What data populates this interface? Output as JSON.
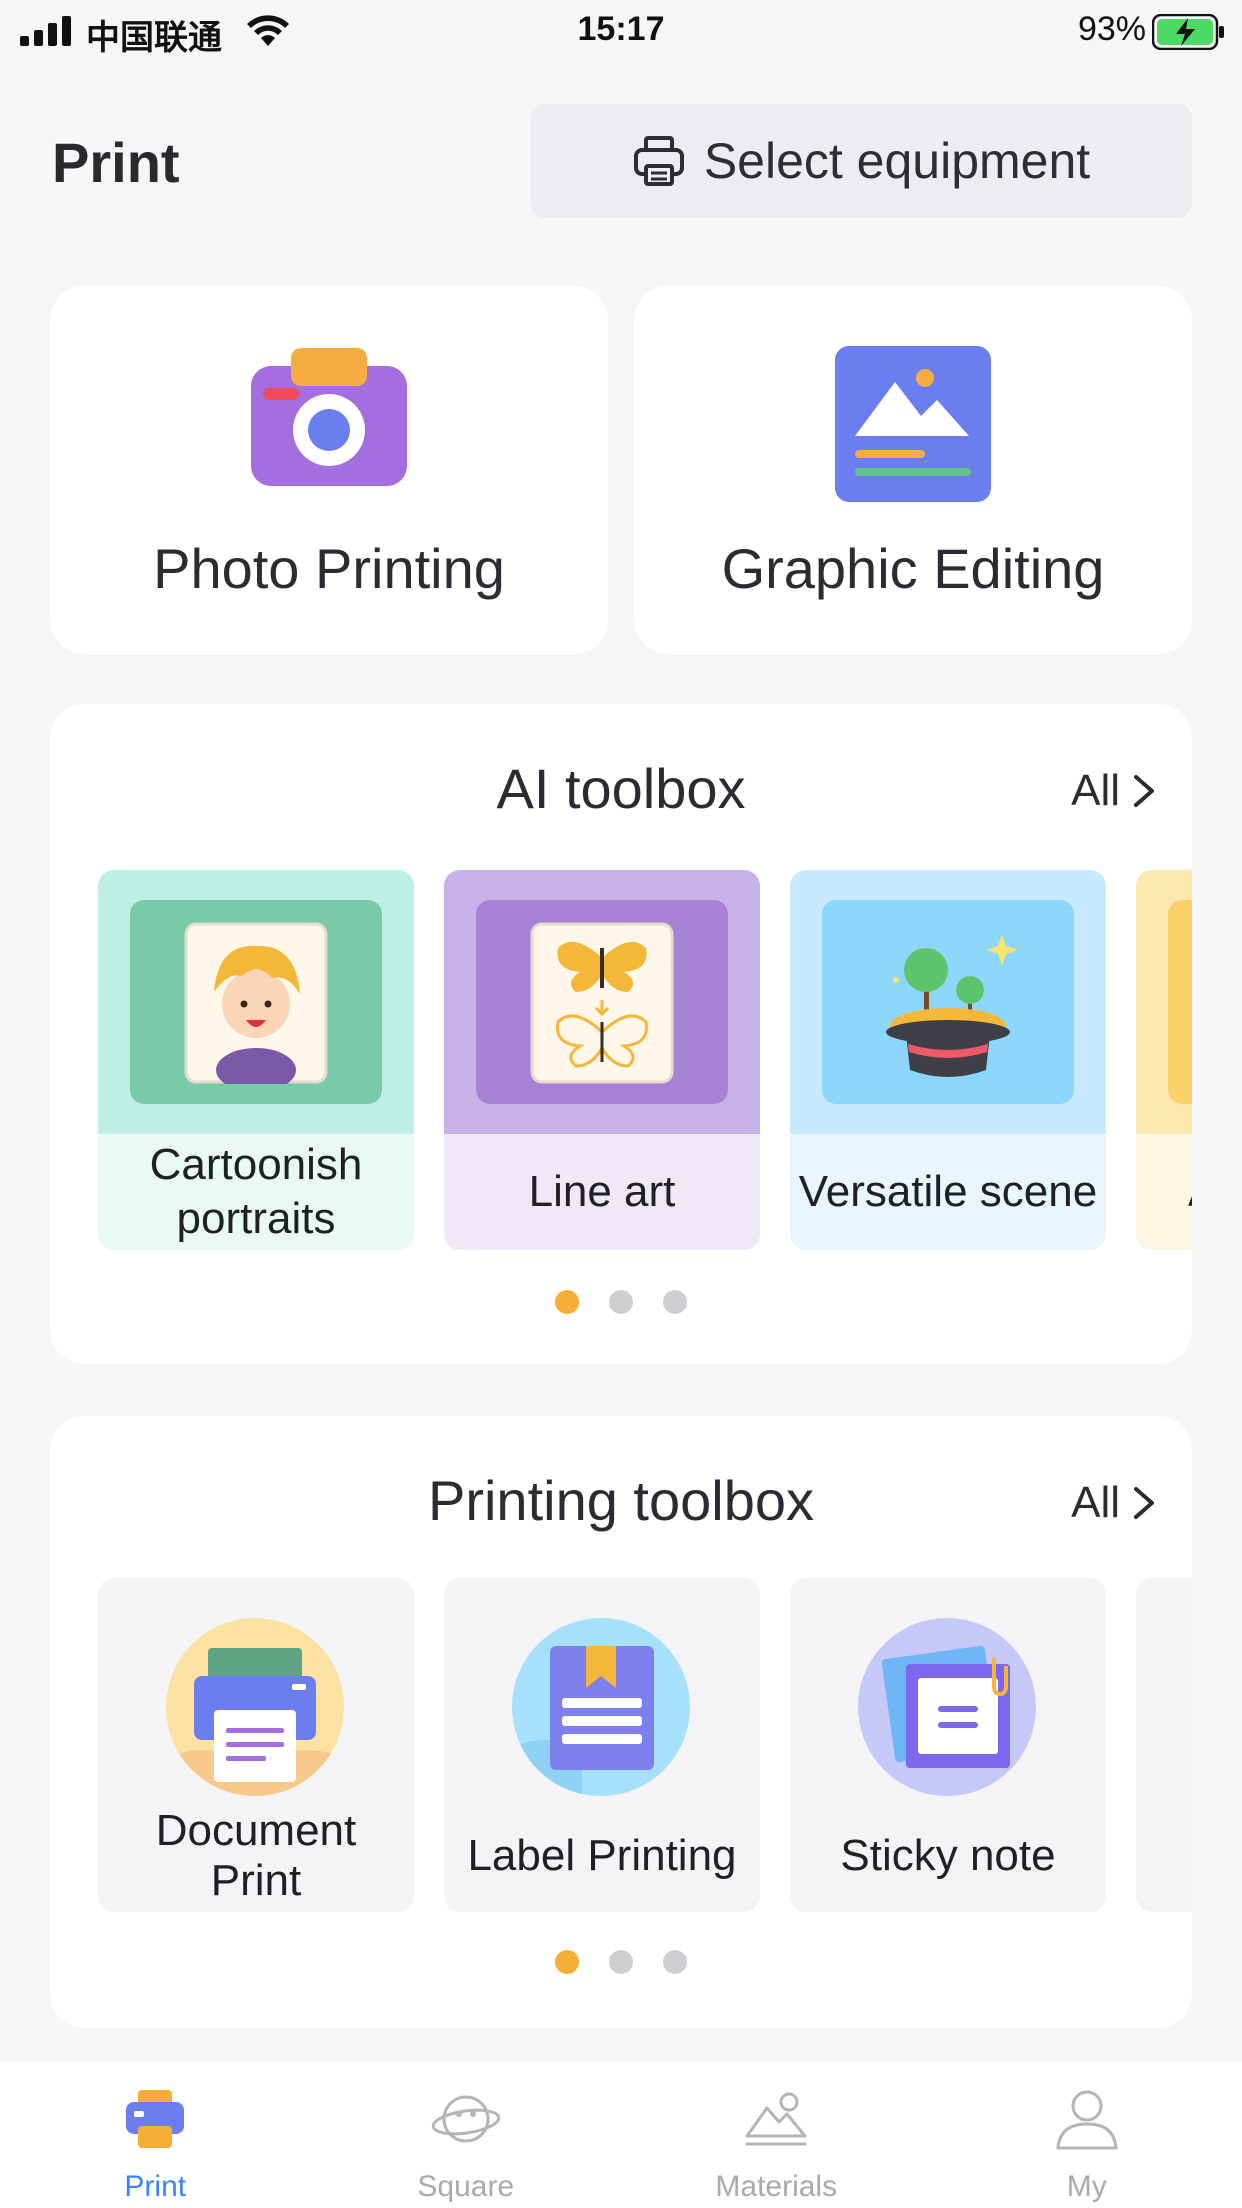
{
  "status_bar": {
    "carrier": "中国联通",
    "time": "15:17",
    "battery": "93%"
  },
  "header": {
    "title": "Print",
    "select_equipment": "Select equipment"
  },
  "top_cards": [
    {
      "label": "Photo Printing",
      "icon": "camera-icon"
    },
    {
      "label": "Graphic Editing",
      "icon": "image-icon"
    }
  ],
  "ai_toolbox": {
    "title": "AI toolbox",
    "all_label": "All",
    "items": [
      {
        "label": "Cartoonish portraits",
        "line1": "Cartoonish",
        "line2": "portraits",
        "icon": "cartoon-portrait-icon"
      },
      {
        "label": "Line art",
        "icon": "butterfly-line-art-icon"
      },
      {
        "label": "Versatile scene",
        "icon": "magic-hat-scene-icon"
      },
      {
        "label": "A",
        "icon": "partial-tile"
      }
    ],
    "page_count": 3,
    "active_page": 0
  },
  "printing_toolbox": {
    "title": "Printing toolbox",
    "all_label": "All",
    "items": [
      {
        "label": "Document Print",
        "line1": "Document",
        "line2": "Print",
        "icon": "document-printer-icon"
      },
      {
        "label": "Label Printing",
        "icon": "label-book-icon"
      },
      {
        "label": "Sticky note",
        "icon": "sticky-note-icon"
      }
    ],
    "page_count": 3,
    "active_page": 0
  },
  "tab_bar": [
    {
      "label": "Print",
      "icon": "printer-tab-icon",
      "active": true
    },
    {
      "label": "Square",
      "icon": "planet-tab-icon",
      "active": false
    },
    {
      "label": "Materials",
      "icon": "mountain-image-tab-icon",
      "active": false
    },
    {
      "label": "My",
      "icon": "person-tab-icon",
      "active": false
    }
  ],
  "colors": {
    "accent_orange": "#f6ad35",
    "tab_active": "#3a86f7",
    "background": "#f6f6f7"
  }
}
